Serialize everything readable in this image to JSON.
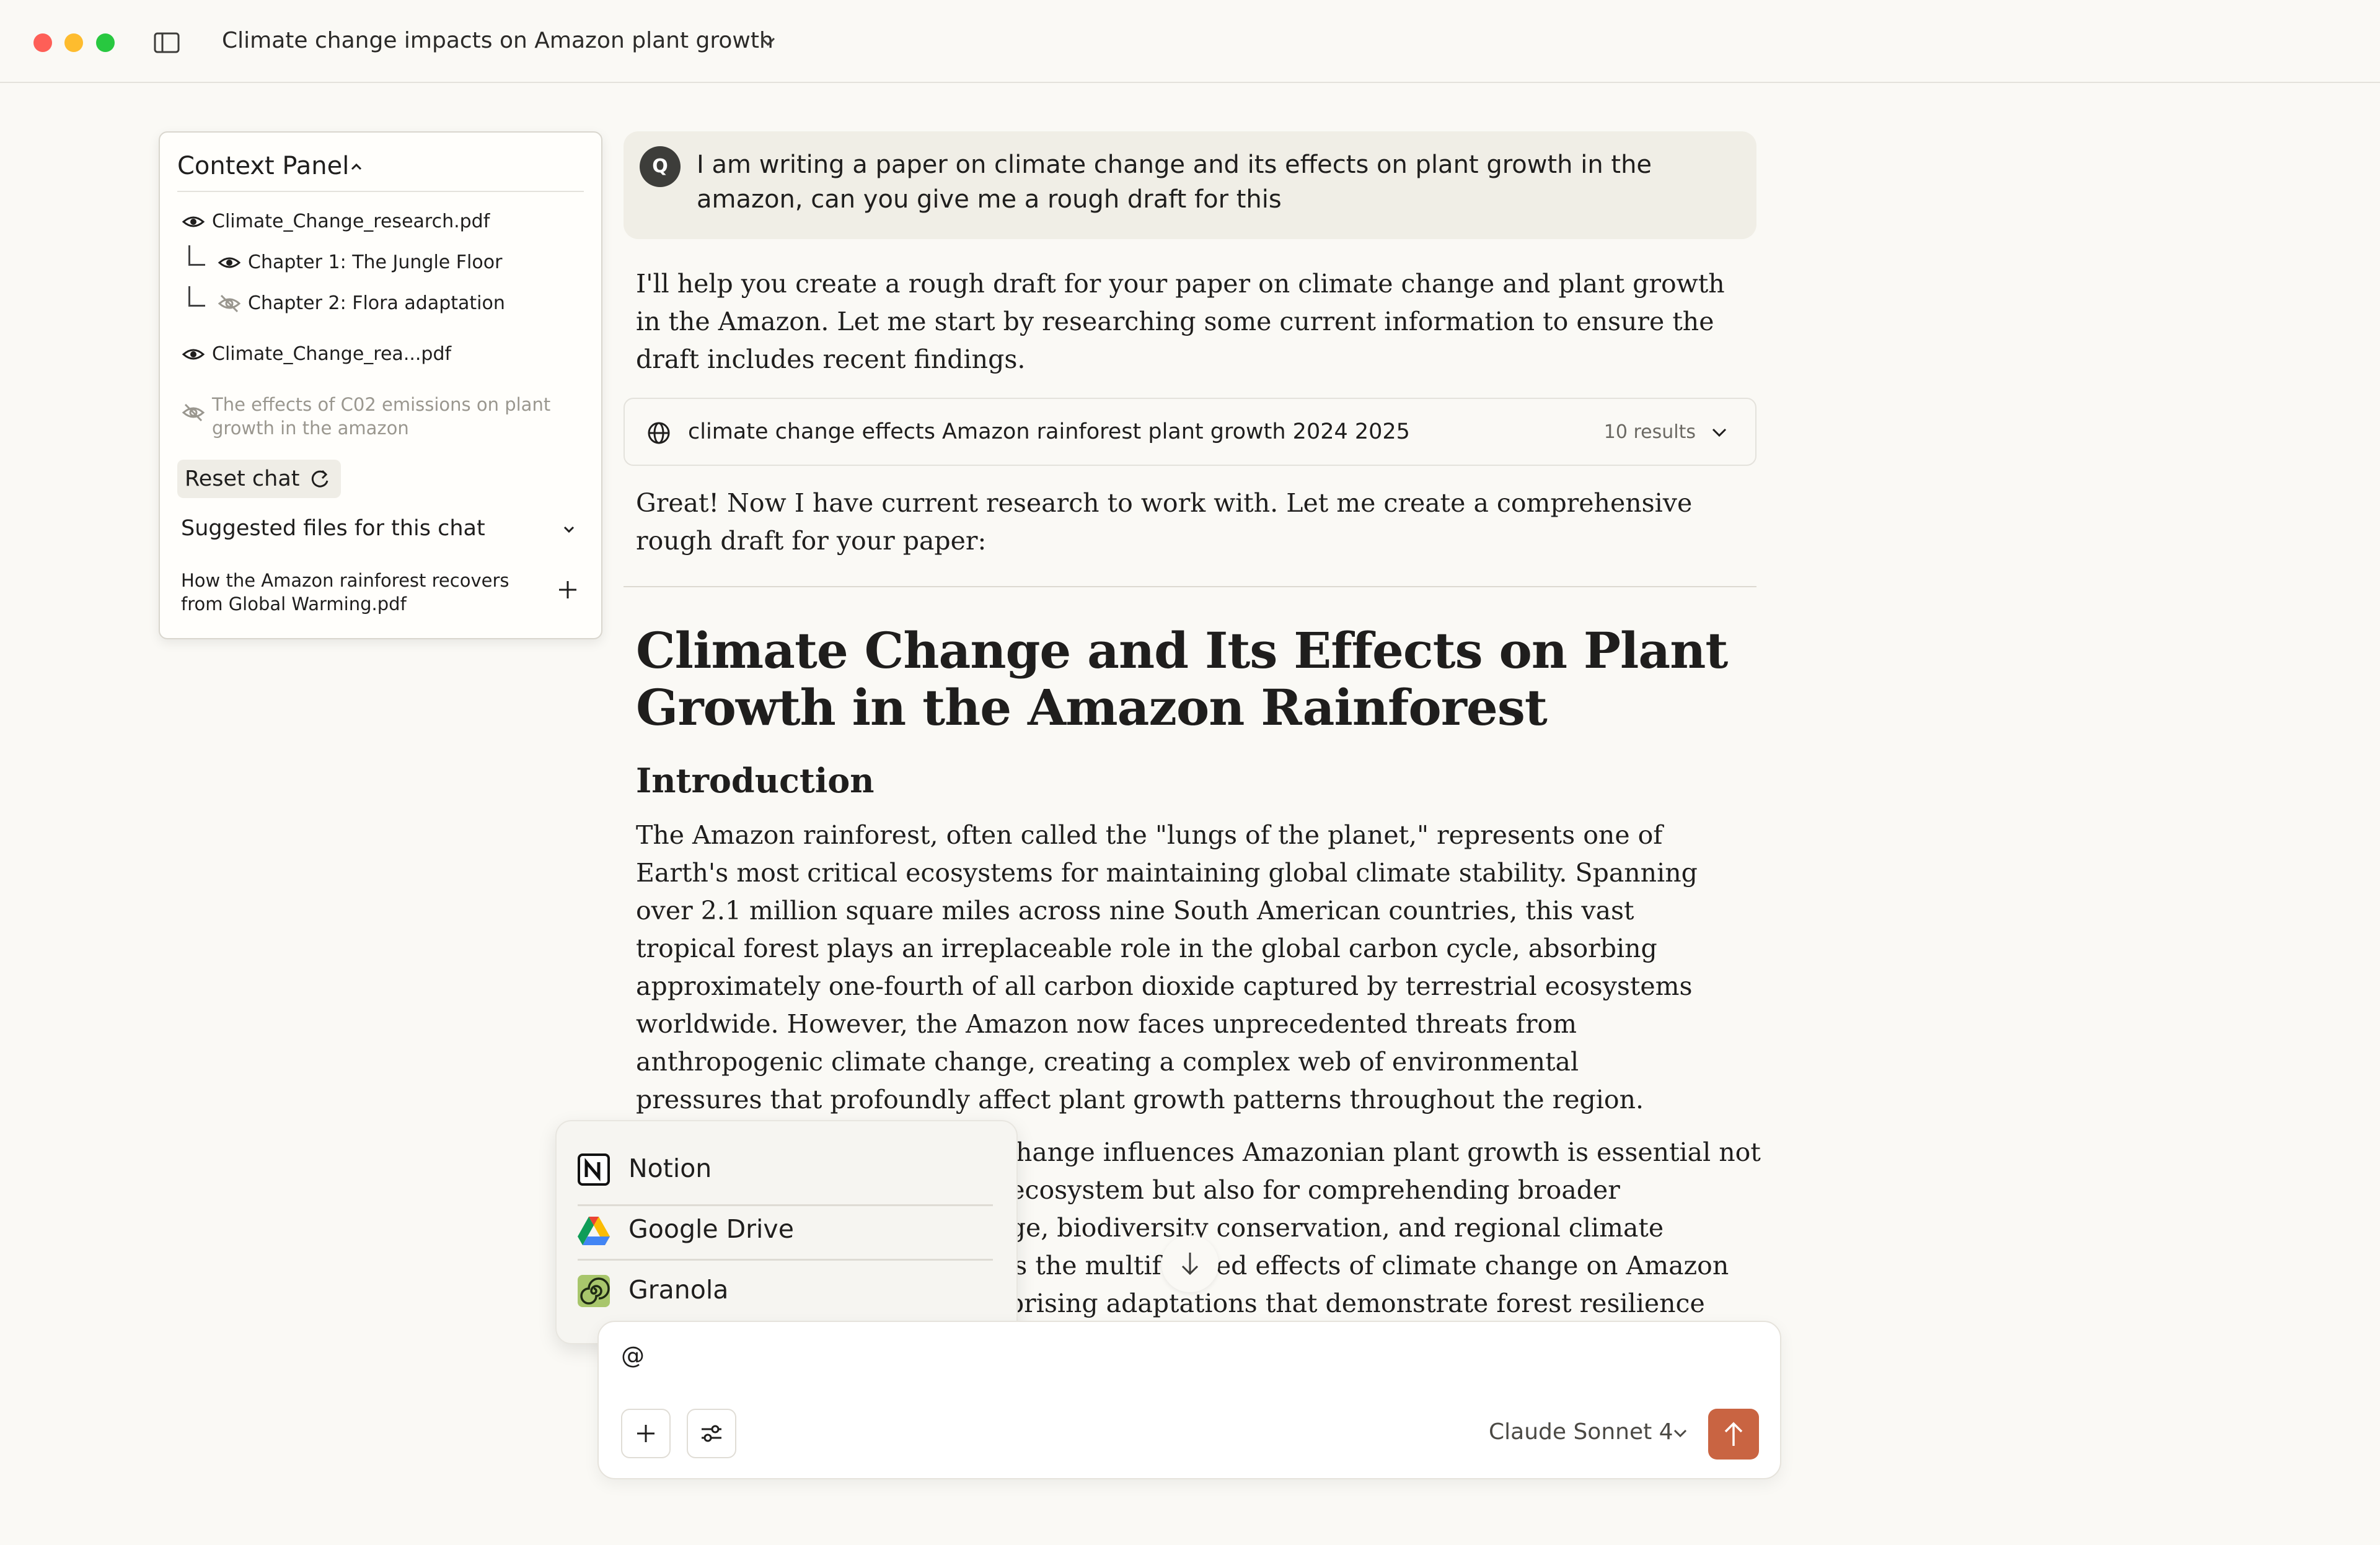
{
  "window": {
    "title": "Climate change impacts on Amazon plant growth"
  },
  "context_panel": {
    "header": "Context Panel",
    "files": [
      {
        "name": "Climate_Change_research.pdf",
        "visible": true
      },
      {
        "name": "Chapter 1: The Jungle Floor",
        "visible": true
      },
      {
        "name": "Chapter 2: Flora adaptation",
        "visible": false
      },
      {
        "name": "Climate_Change_rea...pdf",
        "visible": true
      },
      {
        "name": "The effects of C02 emissions on plant growth in the amazon",
        "visible": false
      }
    ],
    "reset_label": "Reset chat",
    "suggested_label": "Suggested files for this chat",
    "suggested_file": "How the Amazon rainforest recovers from Global Warming.pdf"
  },
  "chat": {
    "user_avatar": "Q",
    "user_message": "I am writing a paper on climate change and its effects on plant growth in the amazon, can you give me a rough draft for this",
    "assistant_intro": "I'll help you create a rough draft for your paper on climate change and plant growth in the Amazon. Let me start by researching some current information to ensure the draft includes recent findings.",
    "search": {
      "query": "climate change effects Amazon rainforest plant growth 2024 2025",
      "results": "10 results"
    },
    "assistant_followup": "Great! Now I have current research to work with. Let me create a comprehensive rough draft for your paper:",
    "doc_title": "Climate Change and Its Effects on Plant Growth in the Amazon Rainforest",
    "doc_section": "Introduction",
    "doc_para1": "The Amazon rainforest, often called the \"lungs of the planet,\" represents one of Earth's most critical ecosystems for maintaining global climate stability. Spanning over 2.1 million square miles across nine South American countries, this vast tropical forest plays an irreplaceable role in the global carbon cycle, absorbing approximately one-fourth of all carbon dioxide captured by terrestrial ecosystems worldwide. However, the Amazon now faces unprecedented threats from anthropogenic climate change, creating a complex web of environmental pressures that profoundly affect plant growth patterns throughout the region.",
    "doc_para2_lines": [
      "Understanding how climate change influences Amazonian plant growth is essential not",
      "only for preserving this vital ecosystem but also for comprehending broader",
      "implications for carbon storage, biodiversity conservation, and regional climate",
      "patterns. This paper examines the multifaceted effects of climate change on Amazon",
      "vegetation, including the surprising adaptations that demonstrate forest resilience"
    ]
  },
  "mention_menu": {
    "items": [
      "Notion",
      "Google Drive",
      "Granola"
    ]
  },
  "composer": {
    "value": "@",
    "model": "Claude Sonnet 4"
  },
  "colors": {
    "accent": "#c96442",
    "background": "#faf9f5",
    "bubble": "#f0eee6"
  }
}
